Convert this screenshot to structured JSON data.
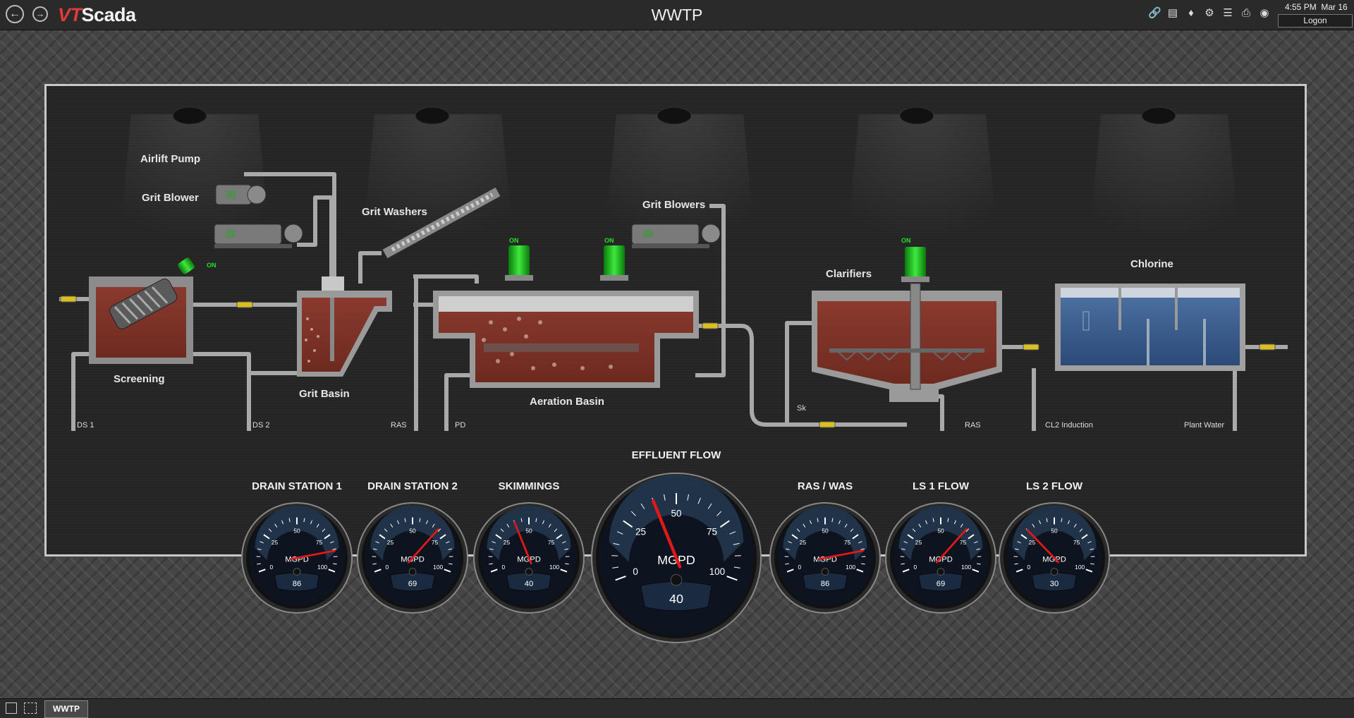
{
  "app": {
    "logo_vt": "VT",
    "logo_scada": "Scada",
    "title": "WWTP"
  },
  "status": {
    "time": "4:55 PM",
    "date": "Mar 16",
    "logon_label": "Logon"
  },
  "toolbar_icons": [
    "link-icon",
    "image-icon",
    "tag-icon",
    "alarm-config-icon",
    "report-icon",
    "print-icon",
    "bell-icon"
  ],
  "process": {
    "airlift_pump": "Airlift Pump",
    "grit_blower": "Grit Blower",
    "grit_washers": "Grit Washers",
    "grit_blowers": "Grit Blowers",
    "screening": "Screening",
    "grit_basin": "Grit Basin",
    "aeration_basin": "Aeration Basin",
    "clarifiers": "Clarifiers",
    "chlorine": "Chlorine",
    "on": "ON",
    "lines": {
      "ds1": "DS 1",
      "ds2": "DS 2",
      "ras1": "RAS",
      "pd": "PD",
      "sk": "Sk",
      "ras2": "RAS",
      "cl2": "CL2 Induction",
      "plant_water": "Plant Water"
    }
  },
  "gauges": [
    {
      "title": "DRAIN STATION 1",
      "unit": "MGPD",
      "value": "86",
      "level": 86
    },
    {
      "title": "DRAIN STATION 2",
      "unit": "MGPD",
      "value": "69",
      "level": 69
    },
    {
      "title": "SKIMMINGS",
      "unit": "MGPD",
      "value": "40",
      "level": 40
    },
    {
      "title": "EFFLUENT FLOW",
      "unit": "MGPD",
      "value": "40",
      "level": 40
    },
    {
      "title": "RAS / WAS",
      "unit": "MGPD",
      "value": "86",
      "level": 86
    },
    {
      "title": "LS 1 FLOW",
      "unit": "MGPD",
      "value": "69",
      "level": 69
    },
    {
      "title": "LS 2 FLOW",
      "unit": "MGPD",
      "value": "30",
      "level": 30
    }
  ],
  "gauge_scale": [
    "0",
    "25",
    "50",
    "75",
    "100"
  ],
  "taskbar": {
    "tab": "WWTP"
  }
}
